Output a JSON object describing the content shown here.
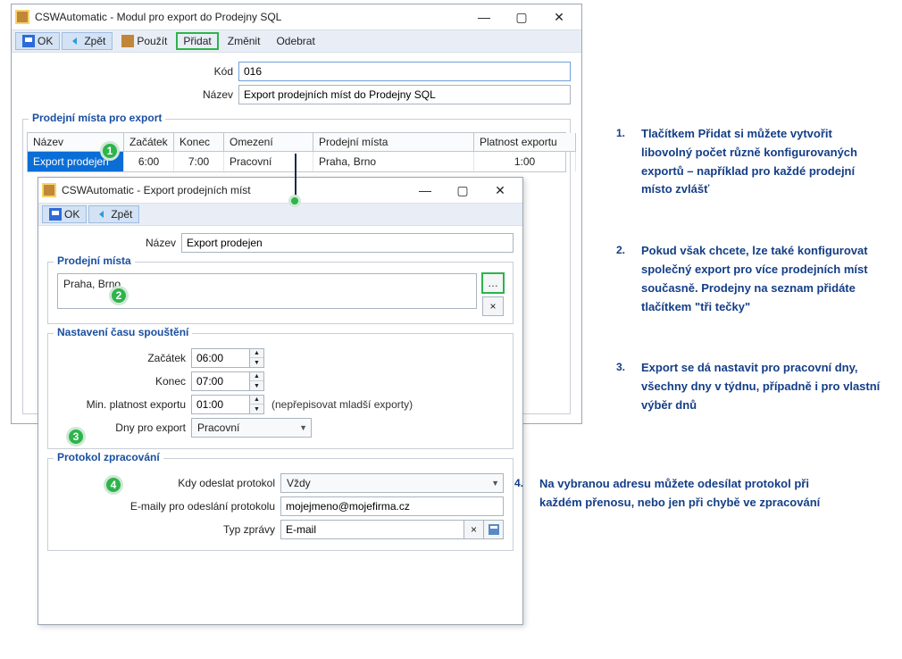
{
  "main": {
    "title": "CSWAutomatic - Modul pro export do Prodejny SQL",
    "toolbar": {
      "ok": "OK",
      "back": "Zpět",
      "use": "Použít",
      "add": "Přidat",
      "change": "Změnit",
      "remove": "Odebrat"
    },
    "form": {
      "kod_label": "Kód",
      "kod_value": "016",
      "nazev_label": "Název",
      "nazev_value": "Export prodejních míst do Prodejny SQL"
    },
    "group_title": "Prodejní místa pro export",
    "grid": {
      "headers": [
        "Název",
        "Začátek",
        "Konec",
        "Omezení",
        "Prodejní místa",
        "Platnost exportu"
      ],
      "row": [
        "Export prodejen",
        "6:00",
        "7:00",
        "Pracovní",
        "Praha, Brno",
        "1:00"
      ]
    }
  },
  "child": {
    "title": "CSWAutomatic - Export prodejních míst",
    "toolbar": {
      "ok": "OK",
      "back": "Zpět"
    },
    "nazev_label": "Název",
    "nazev_value": "Export prodejen",
    "group_places": "Prodejní místa",
    "places_value": "Praha, Brno",
    "group_time": "Nastavení času spouštění",
    "start_label": "Začátek",
    "start_value": "06:00",
    "end_label": "Konec",
    "end_value": "07:00",
    "minplat_label": "Min. platnost exportu",
    "minplat_value": "01:00",
    "minplat_note": "(nepřepisovat mladší exporty)",
    "days_label": "Dny pro export",
    "days_value": "Pracovní",
    "group_proto": "Protokol zpracování",
    "proto_when_label": "Kdy odeslat protokol",
    "proto_when_value": "Vždy",
    "proto_mail_label": "E-maily pro odeslání protokolu",
    "proto_mail_value": "mojejmeno@mojefirma.cz",
    "proto_type_label": "Typ zprávy",
    "proto_type_value": "E-mail"
  },
  "legend": {
    "1": "Tlačítkem Přidat si můžete vytvořit libovolný počet různě konfigurovaných exportů – například pro každé prodejní místo zvlášť",
    "2": "Pokud však chcete, lze také konfigurovat společný export pro více prodejních míst současně. Prodejny na seznam přidáte tlačítkem \"tři tečky\"",
    "3": "Export se dá nastavit pro pracovní dny, všechny dny v týdnu, případně i pro vlastní výběr dnů",
    "4": "Na vybranou adresu můžete odesílat protokol při každém přenosu, nebo jen při chybě ve zpracování"
  },
  "badges": {
    "1": "1",
    "2": "2",
    "3": "3",
    "4": "4"
  }
}
